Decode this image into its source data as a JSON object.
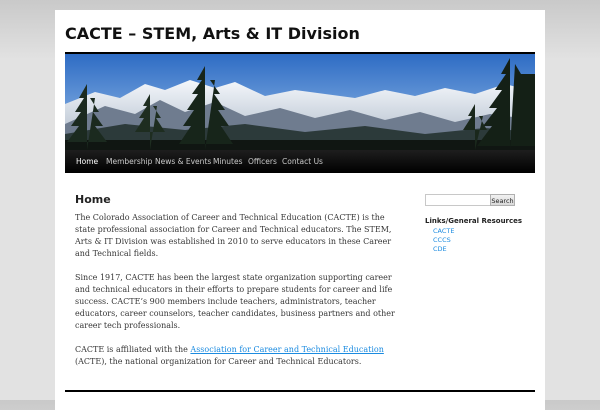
{
  "site": {
    "title": "CACTE – STEM, Arts & IT Division"
  },
  "nav": {
    "items": [
      {
        "label": "Home"
      },
      {
        "label": "Membership"
      },
      {
        "label": "News & Events"
      },
      {
        "label": "Minutes"
      },
      {
        "label": "Officers"
      },
      {
        "label": "Contact Us"
      }
    ]
  },
  "main": {
    "title": "Home",
    "paragraphs": [
      "The Colorado Association of Career and Technical Education (CACTE) is the state professional association for Career and Technical educators.  The STEM, Arts & IT Division was established in 2010 to serve educators in these Career and Technical fields.",
      "Since 1917, CACTE has been the largest state organization supporting career and technical educators in their efforts to prepare students for career and life success. CACTE’s 900 members include teachers, administrators, teacher educators, career counselors, teacher candidates, business partners and other career tech professionals."
    ],
    "affiliation": {
      "before": "CACTE is affiliated with the ",
      "link": "Association for Career and Technical Education",
      "after": " (ACTE), the national organization for Career and Technical Educators."
    }
  },
  "sidebar": {
    "search": {
      "value": "",
      "button_label": "Search"
    },
    "links_heading": "Links/General Resources",
    "links": [
      {
        "label": "CACTE"
      },
      {
        "label": "CCCS"
      },
      {
        "label": "CDE"
      }
    ]
  },
  "colors": {
    "link": "#1b8be0",
    "nav_background": "#000000",
    "page_background": "#e2e2e2"
  }
}
